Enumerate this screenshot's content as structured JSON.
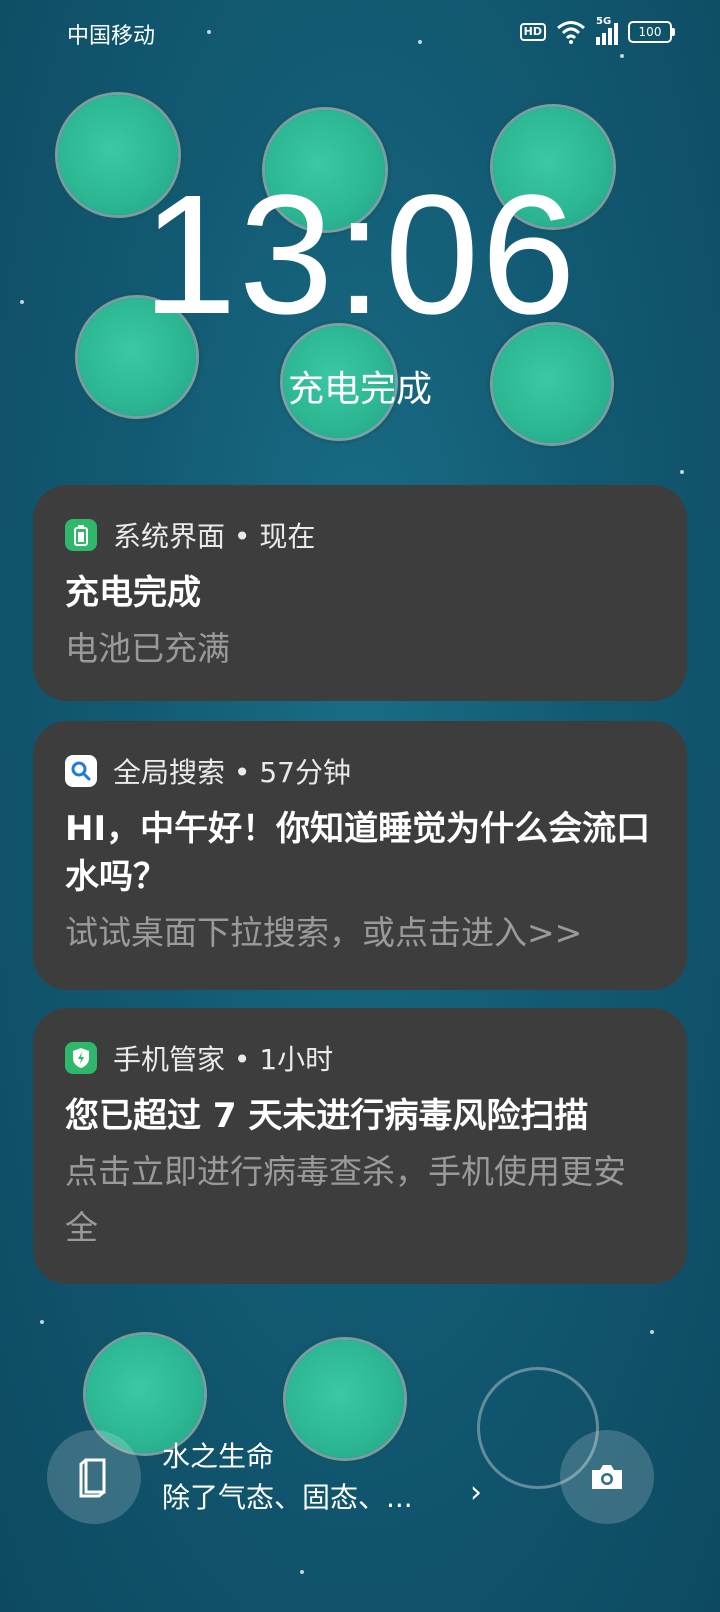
{
  "status_bar": {
    "carrier": "中国移动",
    "hd": "HD",
    "network": "5G",
    "battery": "100"
  },
  "lockscreen": {
    "time": "13:06",
    "charge_status": "充电完成"
  },
  "notifications": [
    {
      "app": "系统界面 • 现在",
      "icon": "battery-icon",
      "title": "充电完成",
      "body": "电池已充满"
    },
    {
      "app": "全局搜索 • 57分钟",
      "icon": "search-icon",
      "title": "HI，中午好！你知道睡觉为什么会流口水吗？",
      "body": "试试桌面下拉搜索，或点击进入>>"
    },
    {
      "app": "手机管家 • 1小时",
      "icon": "shield-icon",
      "title": "您已超过 7 天未进行病毒风险扫描",
      "body": "点击立即进行病毒查杀，手机使用更安全"
    }
  ],
  "bottom": {
    "magazine_title": "水之生命",
    "magazine_desc": "除了气态、固态、...",
    "arrow": "›"
  },
  "colors": {
    "card_bg": "#3d3d3d",
    "accent_green": "#2fb86b",
    "body_text": "#9a9a9a"
  }
}
